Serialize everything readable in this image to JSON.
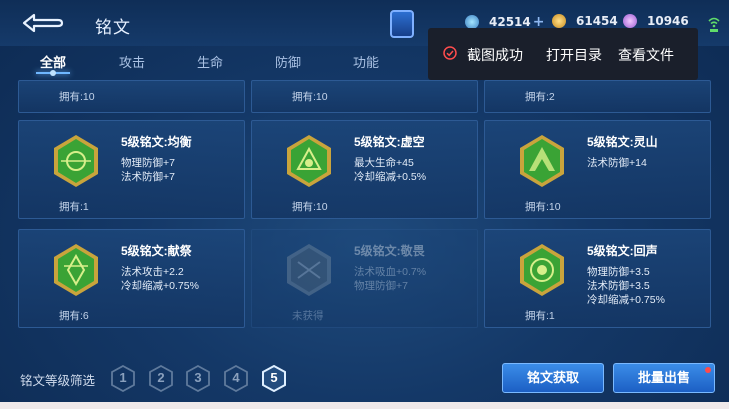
{
  "header": {
    "title": "铭文",
    "currencies": [
      {
        "name": "diamond",
        "value": "42514",
        "plus": "+"
      },
      {
        "name": "gold",
        "value": "61454"
      },
      {
        "name": "crystal",
        "value": "10946"
      }
    ]
  },
  "tabs": [
    {
      "label": "全部",
      "active": true
    },
    {
      "label": "攻击"
    },
    {
      "label": "生命"
    },
    {
      "label": "防御"
    },
    {
      "label": "功能"
    }
  ],
  "toast": {
    "message": "截图成功",
    "open_dir": "打开目录",
    "view_file": "查看文件"
  },
  "top_row": [
    {
      "owned": "拥有:10"
    },
    {
      "owned": "拥有:10"
    },
    {
      "owned": "拥有:2"
    }
  ],
  "cards": [
    {
      "name": "5级铭文:均衡",
      "stats": [
        "物理防御+7",
        "法术防御+7"
      ],
      "owned": "拥有:1",
      "color": "#3aa335"
    },
    {
      "name": "5级铭文:虚空",
      "stats": [
        "最大生命+45",
        "冷却缩减+0.5%"
      ],
      "owned": "拥有:10",
      "color": "#3aa335"
    },
    {
      "name": "5级铭文:灵山",
      "stats": [
        "法术防御+14"
      ],
      "owned": "拥有:10",
      "color": "#3aa335"
    },
    {
      "name": "5级铭文:献祭",
      "stats": [
        "法术攻击+2.2",
        "冷却缩减+0.75%"
      ],
      "owned": "拥有:6",
      "color": "#3aa335"
    },
    {
      "name": "5级铭文:敬畏",
      "stats": [
        "法术吸血+0.7%",
        "物理防御+7"
      ],
      "owned": "未获得",
      "color": "#3aa335",
      "dim": true
    },
    {
      "name": "5级铭文:回声",
      "stats": [
        "物理防御+3.5",
        "法术防御+3.5",
        "冷却缩减+0.75%"
      ],
      "owned": "拥有:1",
      "color": "#3aa335"
    }
  ],
  "filter": {
    "label": "铭文等级筛选",
    "levels": [
      "1",
      "2",
      "3",
      "4",
      "5"
    ],
    "active_level": "5"
  },
  "actions": {
    "obtain": "铭文获取",
    "sell": "批量出售"
  }
}
